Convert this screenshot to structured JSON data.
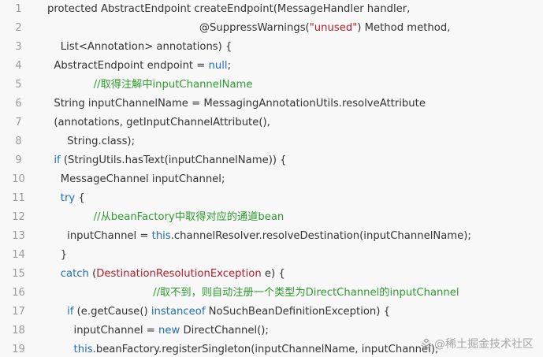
{
  "lines": [
    {
      "num": "1",
      "segments": [
        {
          "t": "protected AbstractEndpoint createEndpoint(MessageHandler handler,",
          "c": ""
        }
      ]
    },
    {
      "num": "2",
      "segments": [
        {
          "t": "                                              @SuppressWarnings(",
          "c": ""
        },
        {
          "t": "\"unused\"",
          "c": "str"
        },
        {
          "t": ") Method method,",
          "c": ""
        }
      ]
    },
    {
      "num": "3",
      "segments": [
        {
          "t": "    List<Annotation> annotations) {",
          "c": ""
        }
      ]
    },
    {
      "num": "4",
      "segments": [
        {
          "t": "  AbstractEndpoint endpoint = ",
          "c": ""
        },
        {
          "t": "null",
          "c": "lit"
        },
        {
          "t": ";",
          "c": ""
        }
      ]
    },
    {
      "num": "5",
      "segments": [
        {
          "t": "              //取得注解中inputChannelName",
          "c": "cmt"
        }
      ]
    },
    {
      "num": "6",
      "segments": [
        {
          "t": "  String inputChannelName = MessagingAnnotationUtils.resolveAttribute",
          "c": ""
        }
      ]
    },
    {
      "num": "7",
      "segments": [
        {
          "t": "  (annotations, getInputChannelAttribute(),",
          "c": ""
        }
      ]
    },
    {
      "num": "8",
      "segments": [
        {
          "t": "      String.class);",
          "c": ""
        }
      ]
    },
    {
      "num": "9",
      "segments": [
        {
          "t": "  ",
          "c": ""
        },
        {
          "t": "if",
          "c": "kw"
        },
        {
          "t": " (StringUtils.hasText(inputChannelName)) {",
          "c": ""
        }
      ]
    },
    {
      "num": "10",
      "segments": [
        {
          "t": "    MessageChannel inputChannel;",
          "c": ""
        }
      ]
    },
    {
      "num": "11",
      "segments": [
        {
          "t": "    ",
          "c": ""
        },
        {
          "t": "try",
          "c": "kw"
        },
        {
          "t": " {",
          "c": ""
        }
      ]
    },
    {
      "num": "12",
      "segments": [
        {
          "t": "              //从beanFactory中取得对应的通道bean",
          "c": "cmt"
        }
      ]
    },
    {
      "num": "13",
      "segments": [
        {
          "t": "      inputChannel = ",
          "c": ""
        },
        {
          "t": "this",
          "c": "kw"
        },
        {
          "t": ".channelResolver.resolveDestination(inputChannelName);",
          "c": ""
        }
      ]
    },
    {
      "num": "14",
      "segments": [
        {
          "t": "    }",
          "c": ""
        }
      ]
    },
    {
      "num": "15",
      "segments": [
        {
          "t": "    ",
          "c": ""
        },
        {
          "t": "catch",
          "c": "kw"
        },
        {
          "t": " (",
          "c": ""
        },
        {
          "t": "DestinationResolutionException",
          "c": "cls"
        },
        {
          "t": " e) {",
          "c": ""
        }
      ]
    },
    {
      "num": "16",
      "segments": [
        {
          "t": "                                //取不到，则自动注册一个类型为DirectChannel的inputChannel",
          "c": "cmt"
        }
      ]
    },
    {
      "num": "17",
      "segments": [
        {
          "t": "      ",
          "c": ""
        },
        {
          "t": "if",
          "c": "kw"
        },
        {
          "t": " (e.getCause() ",
          "c": ""
        },
        {
          "t": "instanceof",
          "c": "kw"
        },
        {
          "t": " NoSuchBeanDefinitionException) {",
          "c": ""
        }
      ]
    },
    {
      "num": "18",
      "segments": [
        {
          "t": "        inputChannel = ",
          "c": ""
        },
        {
          "t": "new",
          "c": "kw"
        },
        {
          "t": " DirectChannel();",
          "c": ""
        }
      ]
    },
    {
      "num": "19",
      "segments": [
        {
          "t": "        ",
          "c": ""
        },
        {
          "t": "this",
          "c": "kw"
        },
        {
          "t": ".beanFactory.registerSingleton(inputChannelName, inputChannel);",
          "c": ""
        }
      ]
    }
  ],
  "watermark": {
    "icon": "juejin-logo-icon",
    "text": "@稀土掘金技术社区"
  },
  "colors": {
    "background": "#f8f8f9",
    "text": "#333333",
    "line_number": "#999999",
    "keyword": "#1f6fb7",
    "string": "#b31d28",
    "comment": "#2e9b2e"
  }
}
